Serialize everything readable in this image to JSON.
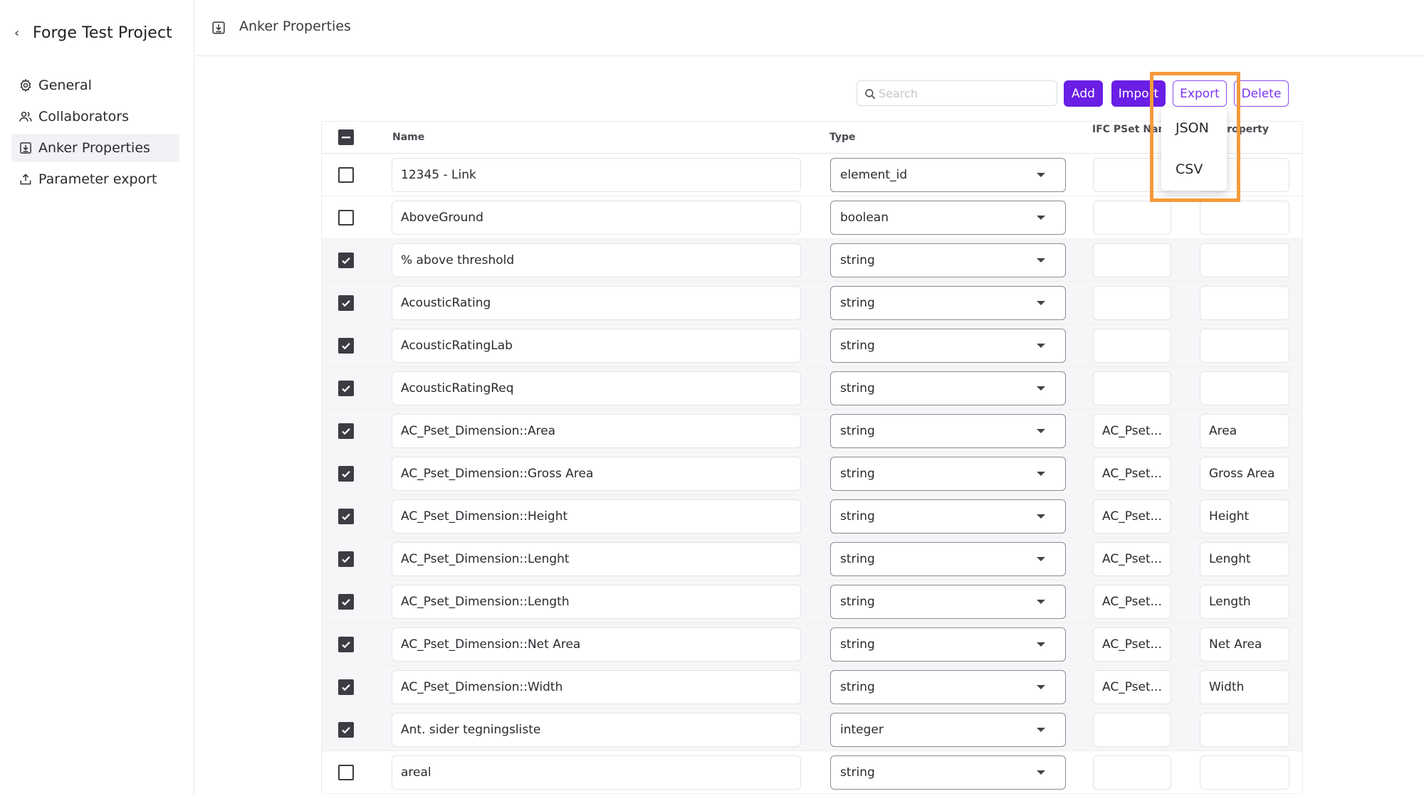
{
  "sidebar": {
    "project_title": "Forge Test Project",
    "items": [
      {
        "label": "General",
        "icon": "gear-icon"
      },
      {
        "label": "Collaborators",
        "icon": "users-icon"
      },
      {
        "label": "Anker Properties",
        "icon": "download-box-icon",
        "active": true
      },
      {
        "label": "Parameter export",
        "icon": "upload-icon"
      }
    ]
  },
  "header": {
    "title": "Anker Properties",
    "icon": "download-box-icon"
  },
  "toolbar": {
    "search_placeholder": "Search",
    "add_label": "Add",
    "import_label": "Import",
    "export_label": "Export",
    "delete_label": "Delete"
  },
  "export_menu": {
    "items": [
      "JSON",
      "CSV"
    ]
  },
  "table": {
    "columns": [
      "Name",
      "Type",
      "IFC PSet Name",
      "Property"
    ],
    "rows": [
      {
        "checked": false,
        "name": "12345 - Link",
        "type": "element_id",
        "pset": "",
        "prop": ""
      },
      {
        "checked": false,
        "name": "AboveGround",
        "type": "boolean",
        "pset": "",
        "prop": ""
      },
      {
        "checked": true,
        "name": "% above threshold",
        "type": "string",
        "pset": "",
        "prop": ""
      },
      {
        "checked": true,
        "name": "AcousticRating",
        "type": "string",
        "pset": "",
        "prop": ""
      },
      {
        "checked": true,
        "name": "AcousticRatingLab",
        "type": "string",
        "pset": "",
        "prop": ""
      },
      {
        "checked": true,
        "name": "AcousticRatingReq",
        "type": "string",
        "pset": "",
        "prop": ""
      },
      {
        "checked": true,
        "name": "AC_Pset_Dimension::Area",
        "type": "string",
        "pset": "AC_Pset...",
        "prop": "Area"
      },
      {
        "checked": true,
        "name": "AC_Pset_Dimension::Gross Area",
        "type": "string",
        "pset": "AC_Pset...",
        "prop": "Gross Area"
      },
      {
        "checked": true,
        "name": "AC_Pset_Dimension::Height",
        "type": "string",
        "pset": "AC_Pset...",
        "prop": "Height"
      },
      {
        "checked": true,
        "name": "AC_Pset_Dimension::Lenght",
        "type": "string",
        "pset": "AC_Pset...",
        "prop": "Lenght"
      },
      {
        "checked": true,
        "name": "AC_Pset_Dimension::Length",
        "type": "string",
        "pset": "AC_Pset...",
        "prop": "Length"
      },
      {
        "checked": true,
        "name": "AC_Pset_Dimension::Net Area",
        "type": "string",
        "pset": "AC_Pset...",
        "prop": "Net Area"
      },
      {
        "checked": true,
        "name": "AC_Pset_Dimension::Width",
        "type": "string",
        "pset": "AC_Pset...",
        "prop": "Width"
      },
      {
        "checked": true,
        "name": "Ant. sider tegningsliste",
        "type": "integer",
        "pset": "",
        "prop": ""
      },
      {
        "checked": false,
        "name": "areal",
        "type": "string",
        "pset": "",
        "prop": ""
      }
    ]
  },
  "colors": {
    "accent": "#6a1ee6",
    "highlight": "#f59a3a"
  }
}
